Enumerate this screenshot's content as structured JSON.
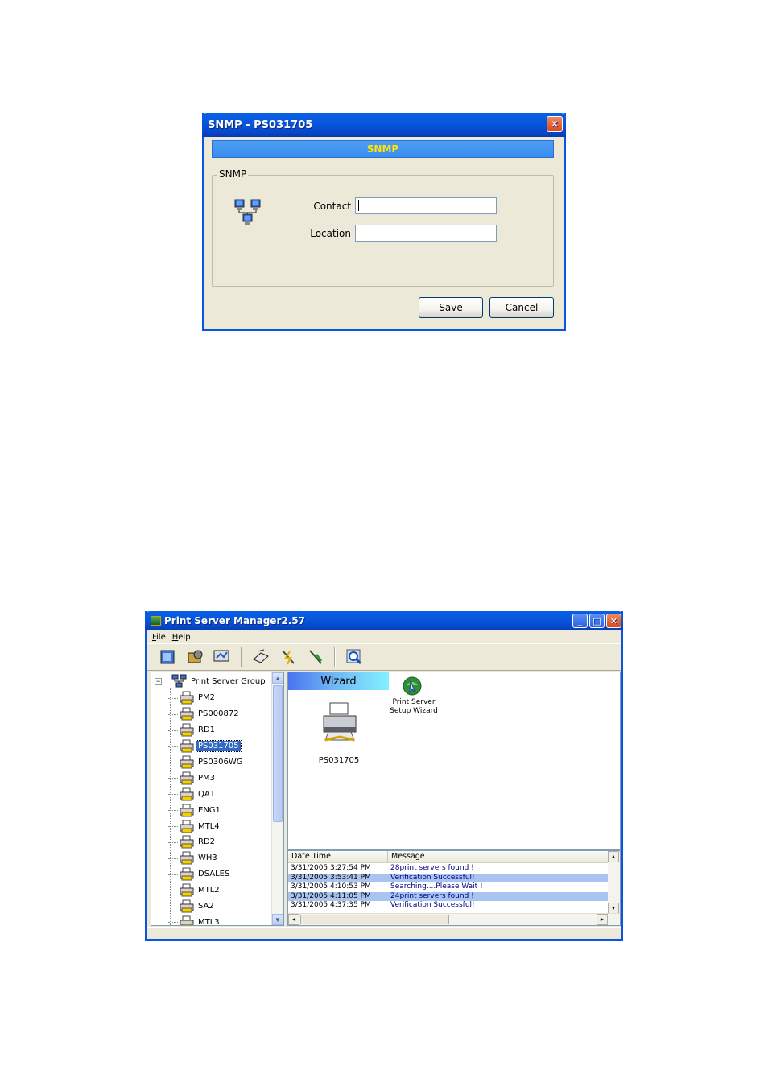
{
  "snmp_dialog": {
    "title": "SNMP - PS031705",
    "banner": "SNMP",
    "group_label": "SNMP",
    "contact_label": "Contact",
    "contact_value": "",
    "location_label": "Location",
    "location_value": "",
    "save_label": "Save",
    "cancel_label": "Cancel",
    "close_glyph": "✕"
  },
  "psm_window": {
    "title": "Print Server Manager2.57",
    "menu": [
      "File",
      "Help"
    ],
    "min_glyph": "_",
    "max_glyph": "□",
    "close_glyph": "✕",
    "toolbar_icons": [
      "properties-icon",
      "setup-icon",
      "monitor-icon",
      "printer-config-icon",
      "connect-icon",
      "disconnect-icon",
      "search-icon"
    ],
    "tree": {
      "root_label": "Print Server Group",
      "expander_glyph": "−",
      "selected": "PS031705",
      "items": [
        "PM2",
        "PS000872",
        "RD1",
        "PS031705",
        "PS0306WG",
        "PM3",
        "QA1",
        "ENG1",
        "MTL4",
        "RD2",
        "WH3",
        "DSALES",
        "MTL2",
        "SA2",
        "MTL3"
      ]
    },
    "wizard_tab": "Wizard",
    "device_label": "PS031705",
    "wizard_label_line1": "Print Server",
    "wizard_label_line2": "Setup Wizard",
    "log": {
      "col_date": "Date Time",
      "col_message": "Message",
      "rows": [
        {
          "time": "3/31/2005 3:27:54 PM",
          "message": "28print servers found !",
          "highlight": false
        },
        {
          "time": "3/31/2005 3:53:41 PM",
          "message": "Verification Successful!",
          "highlight": true
        },
        {
          "time": "3/31/2005 4:10:53 PM",
          "message": "Searching....Please Wait !",
          "highlight": false
        },
        {
          "time": "3/31/2005 4:11:05 PM",
          "message": "24print servers found !",
          "highlight": true
        },
        {
          "time": "3/31/2005 4:37:35 PM",
          "message": "Verification Successful!",
          "highlight": false
        }
      ]
    },
    "colors": {
      "title_blue": "#0858de",
      "highlight": "#a9c4f0",
      "banner_text": "#ffe600"
    }
  }
}
